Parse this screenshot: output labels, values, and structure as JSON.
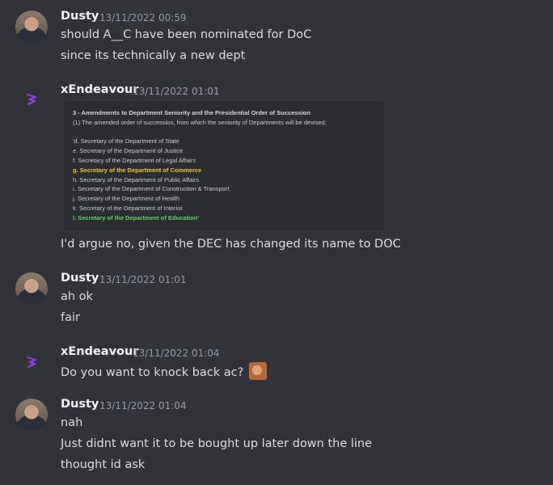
{
  "messages": [
    {
      "author": "Dusty",
      "timestamp": "13/11/2022 00:59",
      "lines": [
        "should A__C have been nominated for DoC",
        "since its technically a new dept"
      ]
    },
    {
      "author": "xEndeavour",
      "timestamp": "13/11/2022 01:01",
      "embed_lines": [
        "3 - Amendments to Department Seniority and the Presidential Order of Succession",
        "(1) The amended order of succession, from which the seniority of Departments will be devised:",
        "'d. Secretary of the Department of State",
        "e. Secretary of the Department of Justice",
        "f. Secretary of the Department of Legal Affairs",
        "g. Secretary of the Department of Commerce",
        "h. Secretary of the Department of Public Affairs",
        "i. Secretary of the Department of Construction & Transport",
        "j. Secretary of the Department of Health",
        "k. Secretary of the Department of Interior",
        "l. Secretary of the Department of Education'"
      ],
      "lines": [
        "I'd argue no, given the DEC has changed its name to DOC"
      ]
    },
    {
      "author": "Dusty",
      "timestamp": "13/11/2022 01:01",
      "lines": [
        "ah ok",
        "fair"
      ]
    },
    {
      "author": "xEndeavour",
      "timestamp": "13/11/2022 01:04",
      "lines": [
        "Do you want to knock back ac?"
      ]
    },
    {
      "author": "Dusty",
      "timestamp": "13/11/2022 01:04",
      "lines": [
        "nah",
        "Just didnt want it to be bought up later down the line",
        "thought id ask"
      ]
    }
  ],
  "colors": {
    "background": "#313338",
    "highlight_yellow": "#f2c12e",
    "highlight_green": "#5fcf6b",
    "logo_purple": "#8b3fe0"
  },
  "icons": {
    "xendeavour_avatar": "purple-e-logo-icon",
    "emoji": "custom-face-emoji-icon"
  }
}
